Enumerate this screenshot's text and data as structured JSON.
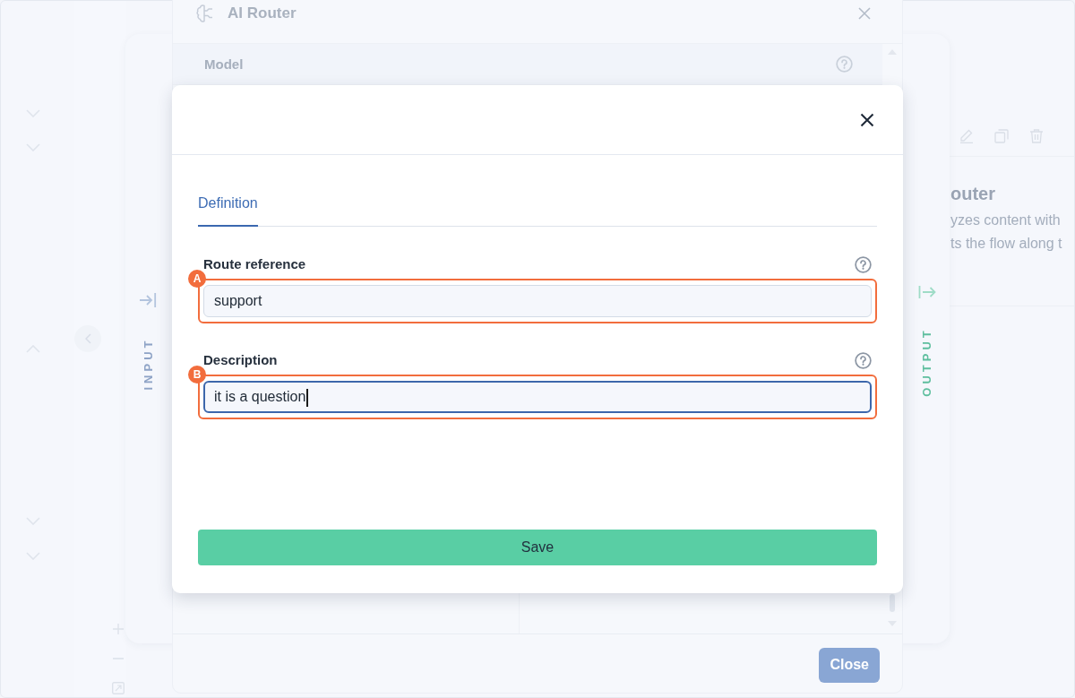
{
  "canvas": {
    "node_card": {
      "title": "outer",
      "description_lines": [
        "yzes content with",
        "ts the flow along t"
      ]
    }
  },
  "side_panel": {
    "input_label": "INPUT",
    "output_label": "OUTPUT"
  },
  "router_dialog": {
    "title": "AI Router",
    "field_label": "Model",
    "close_button": "Close"
  },
  "route_modal": {
    "tabs": [
      {
        "label": "Definition",
        "selected": true
      }
    ],
    "fields": [
      {
        "label": "Route reference",
        "value": "support",
        "focused": false,
        "marker": "A"
      },
      {
        "label": "Description",
        "value": "it is a question",
        "focused": true,
        "marker": "B"
      }
    ],
    "save_button": "Save"
  }
}
